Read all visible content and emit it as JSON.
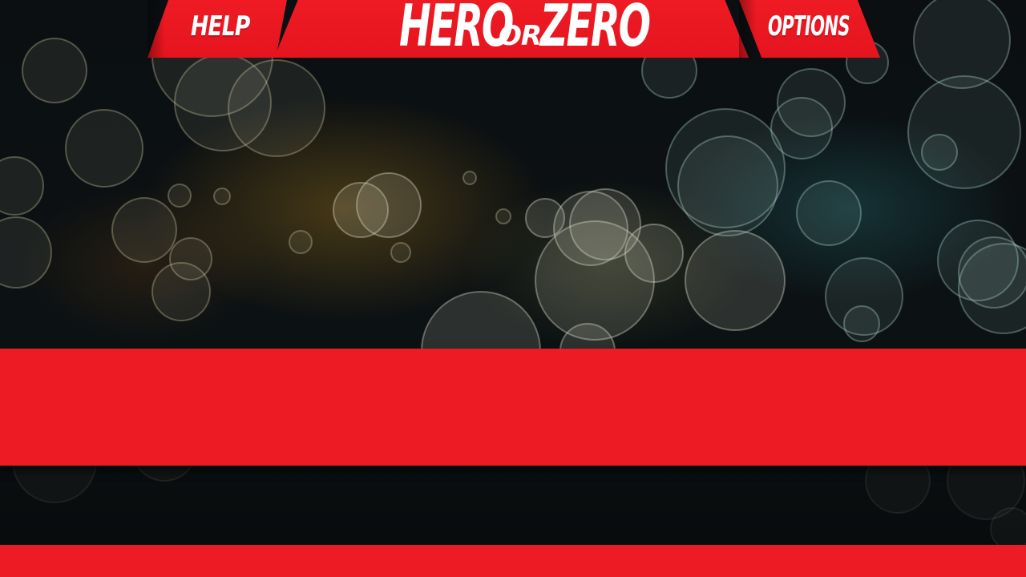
{
  "colors": {
    "accent": "#ed1b24",
    "text": "#ffffff",
    "background": "#0a0e10"
  },
  "header": {
    "help_label": "HELP",
    "logo": {
      "hero": "HERO",
      "or": "OR",
      "zero": "ZERO"
    },
    "options_label": "OPTIONS"
  },
  "main_panel": {
    "text": ""
  },
  "footer": {
    "text": ""
  }
}
